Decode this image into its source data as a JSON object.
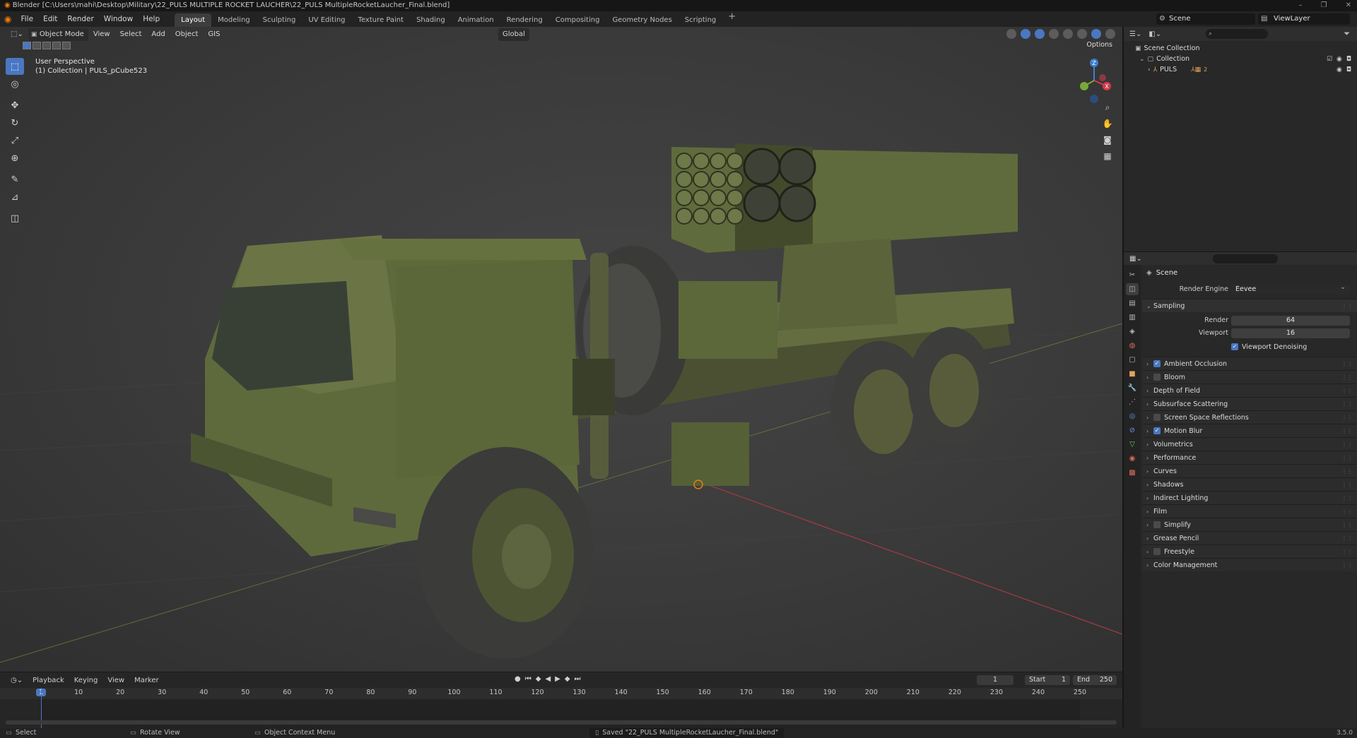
{
  "window": {
    "title": "Blender [C:\\Users\\mahi\\Desktop\\Military\\22_PULS MULTIPLE ROCKET LAUCHER\\22_PULS MultipleRocketLaucher_Final.blend]",
    "controls": [
      "–",
      "❐",
      "✕"
    ]
  },
  "menu": [
    "File",
    "Edit",
    "Render",
    "Window",
    "Help"
  ],
  "workspaces": [
    "Layout",
    "Modeling",
    "Sculpting",
    "UV Editing",
    "Texture Paint",
    "Shading",
    "Animation",
    "Rendering",
    "Compositing",
    "Geometry Nodes",
    "Scripting"
  ],
  "active_workspace": "Layout",
  "scene_selector": "Scene",
  "viewlayer_selector": "ViewLayer",
  "viewport": {
    "mode": "Object Mode",
    "menus": [
      "View",
      "Select",
      "Add",
      "Object",
      "GIS"
    ],
    "transform_orientation": "Global",
    "options_label": "Options",
    "perspective_label": "User Perspective",
    "collection_label": "(1) Collection | PULS_pCube523",
    "gizmo_axes": {
      "x": "X",
      "y": "Y",
      "z": "Z"
    }
  },
  "timeline": {
    "menus": [
      "Playback",
      "Keying",
      "View",
      "Marker"
    ],
    "current_frame": "1",
    "start_label": "Start",
    "start_value": "1",
    "end_label": "End",
    "end_value": "250",
    "ticks": [
      "1",
      "10",
      "20",
      "30",
      "40",
      "50",
      "60",
      "70",
      "80",
      "90",
      "100",
      "110",
      "120",
      "130",
      "140",
      "150",
      "160",
      "170",
      "180",
      "190",
      "200",
      "210",
      "220",
      "230",
      "240",
      "250"
    ]
  },
  "statusbar": {
    "select": "Select",
    "rotate": "Rotate View",
    "context": "Object Context Menu",
    "saved": "Saved \"22_PULS MultipleRocketLaucher_Final.blend\"",
    "version": "3.5.0"
  },
  "outliner": {
    "scene_collection": "Scene Collection",
    "collection": "Collection",
    "object": "PULS",
    "object_badge": "2"
  },
  "properties": {
    "context": "Scene",
    "render_engine_label": "Render Engine",
    "render_engine": "Eevee",
    "sampling_title": "Sampling",
    "render_label": "Render",
    "render_samples": "64",
    "viewport_label": "Viewport",
    "viewport_samples": "16",
    "viewport_denoising": "Viewport Denoising",
    "panels": [
      {
        "label": "Ambient Occlusion",
        "checkbox": true,
        "checked": true
      },
      {
        "label": "Bloom",
        "checkbox": true,
        "checked": false
      },
      {
        "label": "Depth of Field",
        "checkbox": false,
        "checked": false
      },
      {
        "label": "Subsurface Scattering",
        "checkbox": false,
        "checked": false
      },
      {
        "label": "Screen Space Reflections",
        "checkbox": true,
        "checked": false
      },
      {
        "label": "Motion Blur",
        "checkbox": true,
        "checked": true
      },
      {
        "label": "Volumetrics",
        "checkbox": false,
        "checked": false
      },
      {
        "label": "Performance",
        "checkbox": false,
        "checked": false
      },
      {
        "label": "Curves",
        "checkbox": false,
        "checked": false
      },
      {
        "label": "Shadows",
        "checkbox": false,
        "checked": false
      },
      {
        "label": "Indirect Lighting",
        "checkbox": false,
        "checked": false
      },
      {
        "label": "Film",
        "checkbox": false,
        "checked": false
      },
      {
        "label": "Simplify",
        "checkbox": true,
        "checked": false
      },
      {
        "label": "Grease Pencil",
        "checkbox": false,
        "checked": false
      },
      {
        "label": "Freestyle",
        "checkbox": true,
        "checked": false
      },
      {
        "label": "Color Management",
        "checkbox": false,
        "checked": false
      }
    ]
  },
  "colors": {
    "accent": "#4a77c2",
    "brand": "#e87d0d",
    "x_axis": "#d23a4a",
    "y_axis": "#79a83a",
    "z_axis": "#3e7fd0"
  }
}
